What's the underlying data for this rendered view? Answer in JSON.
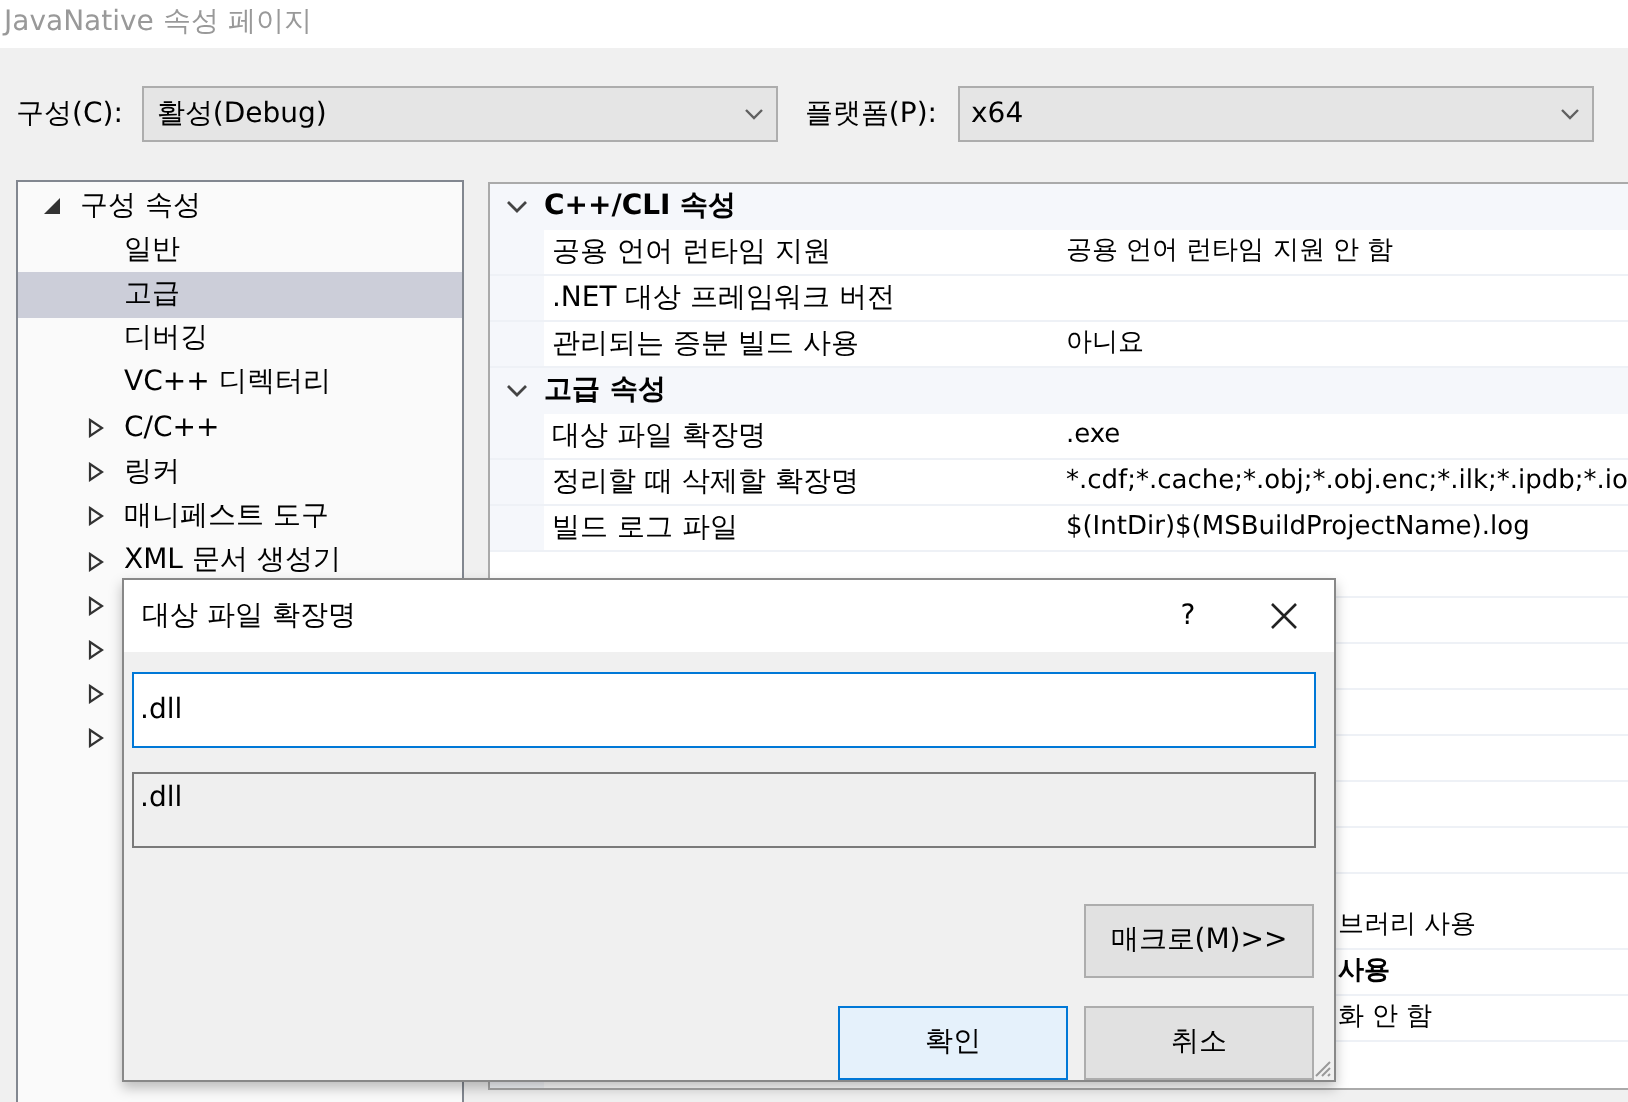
{
  "window": {
    "title": "JavaNative 속성 페이지"
  },
  "configuration": {
    "label": "구성(C):",
    "value": "활성(Debug)"
  },
  "platform": {
    "label": "플랫폼(P):",
    "value": "x64"
  },
  "tree": [
    {
      "label": "구성 속성",
      "expanded": true,
      "selected": false,
      "children": [
        {
          "label": "일반",
          "selected": false
        },
        {
          "label": "고급",
          "selected": true
        },
        {
          "label": "디버깅",
          "selected": false
        },
        {
          "label": "VC++ 디렉터리",
          "selected": false
        },
        {
          "label": "C/C++",
          "expanded": false,
          "selected": false
        },
        {
          "label": "링커",
          "expanded": false,
          "selected": false
        },
        {
          "label": "매니페스트 도구",
          "expanded": false,
          "selected": false
        },
        {
          "label": "XML 문서 생성기",
          "expanded": false,
          "selected": false
        },
        {
          "expanded": false,
          "selected": false
        },
        {
          "expanded": false,
          "selected": false
        },
        {
          "expanded": false,
          "selected": false
        },
        {
          "expanded": false,
          "selected": false
        }
      ]
    }
  ],
  "grid": {
    "sections": [
      {
        "title": "C++/CLI 속성",
        "expanded": true,
        "rows": [
          {
            "name": "공용 언어 런타임 지원",
            "value": "공용 언어 런타임 지원 안 함"
          },
          {
            "name": ".NET 대상 프레임워크 버전"
          },
          {
            "name": "관리되는 증분 빌드 사용",
            "value": "아니요"
          }
        ]
      },
      {
        "title": "고급 속성",
        "expanded": true,
        "rows": [
          {
            "name": "대상 파일 확장명",
            "value": ".exe"
          },
          {
            "name": "정리할 때 삭제할 확장명",
            "value": "*.cdf;*.cache;*.obj;*.obj.enc;*.ilk;*.ipdb;*.io"
          },
          {
            "name": "빌드 로그 파일",
            "value": "$(IntDir)$(MSBuildProjectName).log"
          }
        ]
      }
    ],
    "partial_rows": [
      {
        "value": "브러리 사용",
        "bold": false
      },
      {
        "value": "사용",
        "bold": true
      },
      {
        "value": "화 안 함",
        "bold": false
      }
    ]
  },
  "dialog": {
    "title": "대상 파일 확장명",
    "help": "?",
    "input": {
      "value": ".dll"
    },
    "preview": ".dll",
    "buttons": [
      {
        "label": "매크로(M)>>",
        "kind": "macro"
      },
      {
        "label": "확인",
        "kind": "default"
      },
      {
        "label": "취소",
        "kind": "normal"
      }
    ]
  }
}
